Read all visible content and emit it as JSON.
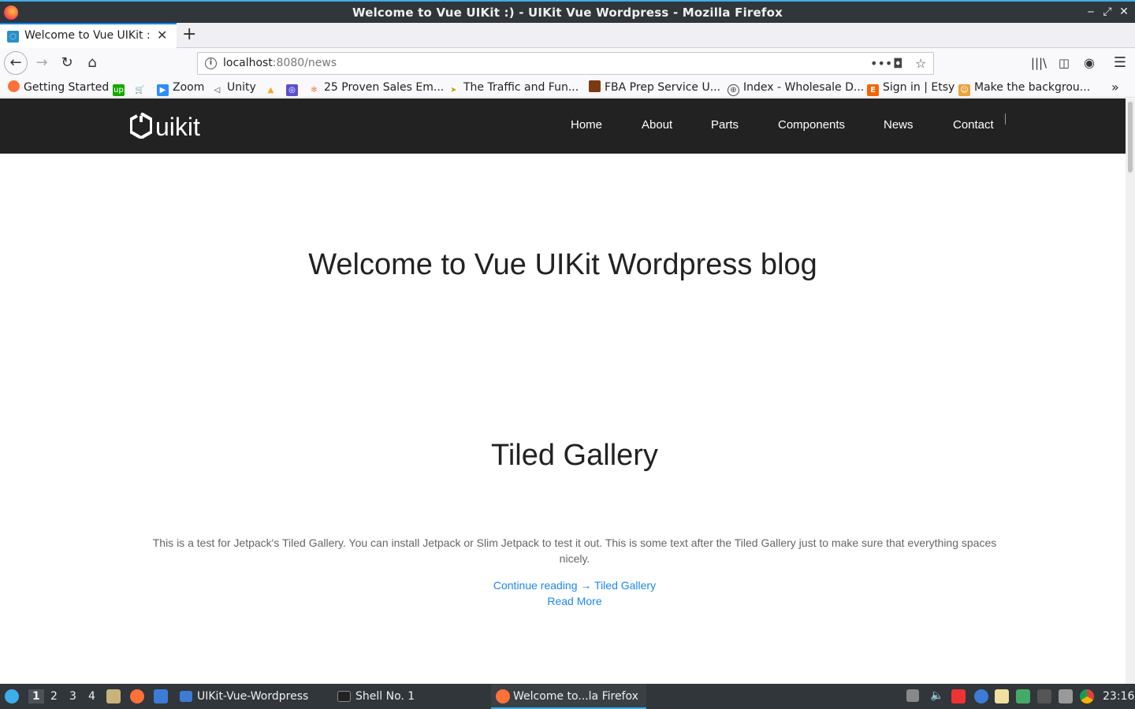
{
  "window": {
    "title": "Welcome to Vue UIKit :) - UIKit Vue Wordpress - Mozilla Firefox"
  },
  "tab": {
    "label": "Welcome to Vue UIKit :) -"
  },
  "urlbar": {
    "host": "localhost",
    "rest": ":8080/news"
  },
  "bookmarks": [
    {
      "label": "Getting Started"
    },
    {
      "label": "Zoom"
    },
    {
      "label": "Unity"
    },
    {
      "label": "25 Proven Sales Em..."
    },
    {
      "label": "The Traffic and Fun..."
    },
    {
      "label": "FBA Prep Service U..."
    },
    {
      "label": "Index - Wholesale D..."
    },
    {
      "label": "Sign in | Etsy"
    },
    {
      "label": "Make the backgrou..."
    }
  ],
  "site": {
    "logo": "uikit",
    "menu": [
      "Home",
      "About",
      "Parts",
      "Components",
      "News",
      "Contact"
    ],
    "hero": "Welcome to Vue UIKit Wordpress blog",
    "post": {
      "title": "Tiled Gallery",
      "excerpt": "This is a test for Jetpack's Tiled Gallery. You can install Jetpack or Slim Jetpack to test it out. This is some text after the Tiled Gallery just to make sure that everything spaces nicely.",
      "continue": "Continue reading → Tiled Gallery",
      "readmore": "Read More"
    }
  },
  "taskbar": {
    "desktops": [
      "1",
      "2",
      "3",
      "4"
    ],
    "tasks": [
      "UIKit-Vue-Wordpress",
      "Shell No. 1",
      "Welcome to...la Firefox"
    ],
    "clock": "23:16"
  },
  "colors": {
    "accent": "#1e87f0",
    "navbar": "#222222",
    "panel": "#31363b"
  }
}
